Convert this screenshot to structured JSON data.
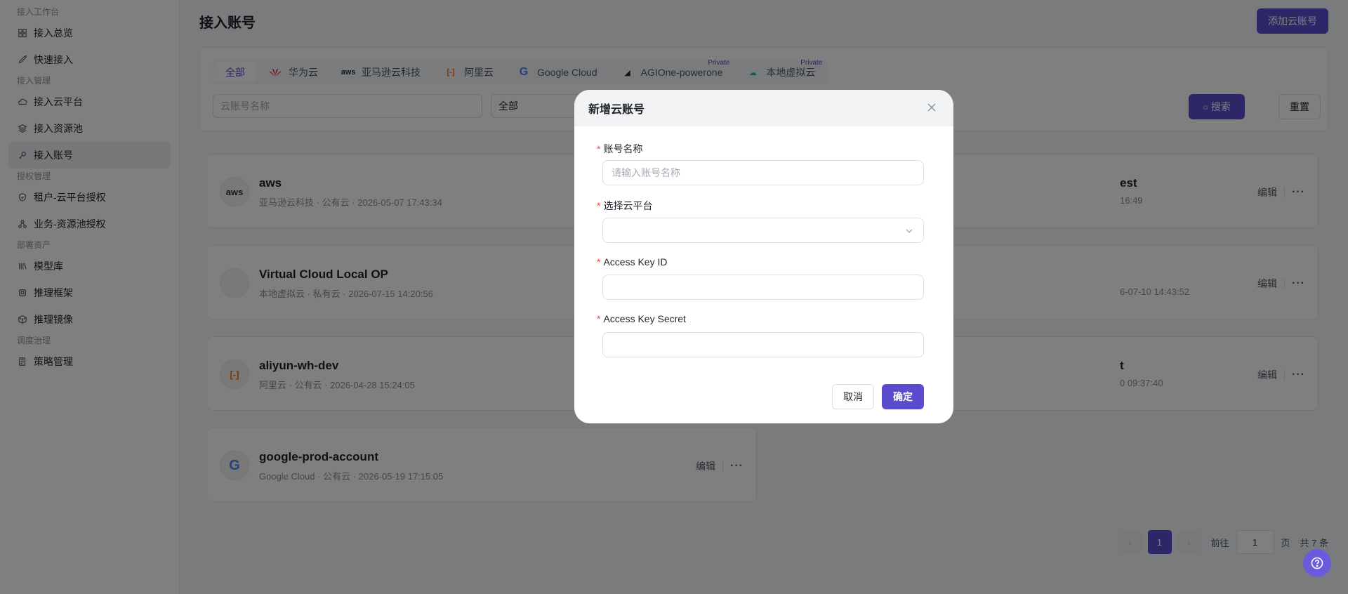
{
  "sidebar": {
    "groups": [
      {
        "title": "接入工作台",
        "items": [
          {
            "label": "接入总览",
            "icon": "grid-icon"
          },
          {
            "label": "快速接入",
            "icon": "rocket-icon"
          }
        ]
      },
      {
        "title": "接入管理",
        "items": [
          {
            "label": "接入云平台",
            "icon": "cloud-icon"
          },
          {
            "label": "接入资源池",
            "icon": "layers-icon"
          },
          {
            "label": "接入账号",
            "icon": "key-icon",
            "active": true
          }
        ]
      },
      {
        "title": "授权管理",
        "items": [
          {
            "label": "租户-云平台授权",
            "icon": "shield-icon"
          },
          {
            "label": "业务-资源池授权",
            "icon": "share-icon"
          }
        ]
      },
      {
        "title": "部署资产",
        "items": [
          {
            "label": "模型库",
            "icon": "library-icon"
          },
          {
            "label": "推理框架",
            "icon": "chip-icon"
          },
          {
            "label": "推理镜像",
            "icon": "box-icon"
          }
        ]
      },
      {
        "title": "调度治理",
        "items": [
          {
            "label": "策略管理",
            "icon": "policy-icon"
          }
        ]
      }
    ]
  },
  "header": {
    "title": "接入账号",
    "add_button": "添加云账号"
  },
  "filters": {
    "tabs": [
      {
        "label": "全部",
        "active": true
      },
      {
        "label": "华为云",
        "logo": "huawei-logo"
      },
      {
        "label": "亚马逊云科技",
        "logo": "aws-logo"
      },
      {
        "label": "阿里云",
        "logo": "aliyun-logo"
      },
      {
        "label": "Google Cloud",
        "logo": "google-logo"
      },
      {
        "label": "AGIOne-powerone",
        "logo": "agione-logo",
        "badge": "Private"
      },
      {
        "label": "本地虚拟云",
        "logo": "localcloud-logo",
        "badge": "Private"
      }
    ],
    "name_placeholder": "云账号名称",
    "type_value": "全部",
    "search_label": "搜索",
    "reset_label": "重置"
  },
  "accounts": [
    {
      "name": "aws",
      "provider": "亚马逊云科技",
      "type": "公有云",
      "time": "2026-05-07 17:43:34",
      "logo_text": "aws"
    },
    {
      "name": "Virtual Cloud Local OP",
      "provider": "本地虚拟云",
      "type": "私有云",
      "time": "2026-07-15 14:20:56",
      "logo_text": ""
    },
    {
      "name": "aliyun-wh-dev",
      "provider": "阿里云",
      "type": "公有云",
      "time": "2026-04-28 15:24:05",
      "logo_text": "[-]"
    },
    {
      "name": "google-prod-account",
      "provider": "Google Cloud",
      "type": "公有云",
      "time": "2026-05-19 17:15:05",
      "logo_text": "G"
    },
    {
      "name": "est",
      "meta_tail": "16:49"
    },
    {
      "name": "",
      "meta_tail": "6-07-10 14:43:52"
    },
    {
      "name": "t",
      "meta_tail": "0 09:37:40"
    }
  ],
  "account_ops": {
    "edit": "编辑",
    "more": "···",
    "sep": "·"
  },
  "pagination": {
    "current": "1",
    "goto_label": "前往",
    "goto_value": "1",
    "page_unit": "页",
    "total": "共 7 条"
  },
  "dialog": {
    "title": "新增云账号",
    "fields": [
      {
        "label": "账号名称",
        "placeholder": "请输入账号名称",
        "value": ""
      },
      {
        "label": "选择云平台",
        "value": "",
        "type": "select"
      },
      {
        "label": "Access Key ID",
        "value": ""
      },
      {
        "label": "Access Key Secret",
        "value": ""
      }
    ],
    "cancel": "取消",
    "confirm": "确定",
    "required_mark": "*"
  },
  "colors": {
    "primary": "#5b4ccf",
    "danger": "#f53f3f"
  }
}
